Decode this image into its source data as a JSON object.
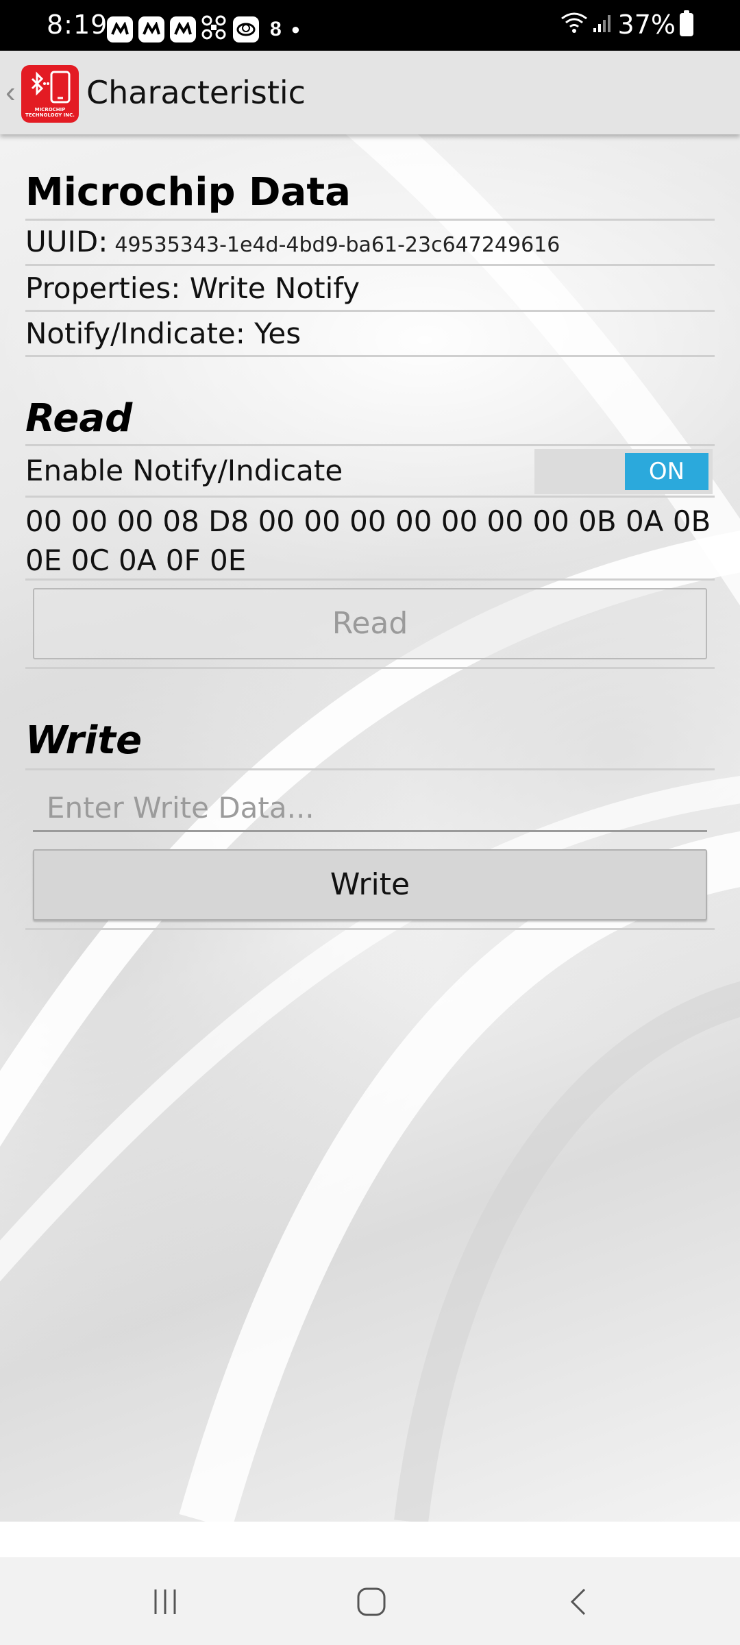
{
  "status_bar": {
    "time": "8:19",
    "extra_icon_text": "8",
    "battery_percent": "37%",
    "battery_level": 0.37
  },
  "app_bar": {
    "title": "Characteristic",
    "logo_text": "MICROCHIP TECHNOLOGY INC."
  },
  "characteristic": {
    "name": "Microchip Data",
    "uuid_label": "UUID:",
    "uuid_value": "49535343-1e4d-4bd9-ba61-23c647249616",
    "properties": "Properties: Write Notify",
    "notify_indicate": "Notify/Indicate: Yes"
  },
  "read_section": {
    "title": "Read",
    "enable_notify_label": "Enable Notify/Indicate",
    "toggle_state": "ON",
    "hex_line_1": "00 00 00 08 D8 00 00 00 00 00 00 00 0B 0A 0B",
    "hex_line_2": "0E 0C 0A 0F 0E",
    "read_button_label": "Read"
  },
  "write_section": {
    "title": "Write",
    "input_value": "",
    "input_placeholder": "Enter Write Data...",
    "write_button_label": "Write"
  },
  "nav_bar": {
    "recents_icon": "recents-icon",
    "home_icon": "home-icon",
    "back_icon": "back-icon"
  },
  "colors": {
    "toggle_on": "#2ba9dc",
    "logo_red": "#e31b23"
  }
}
